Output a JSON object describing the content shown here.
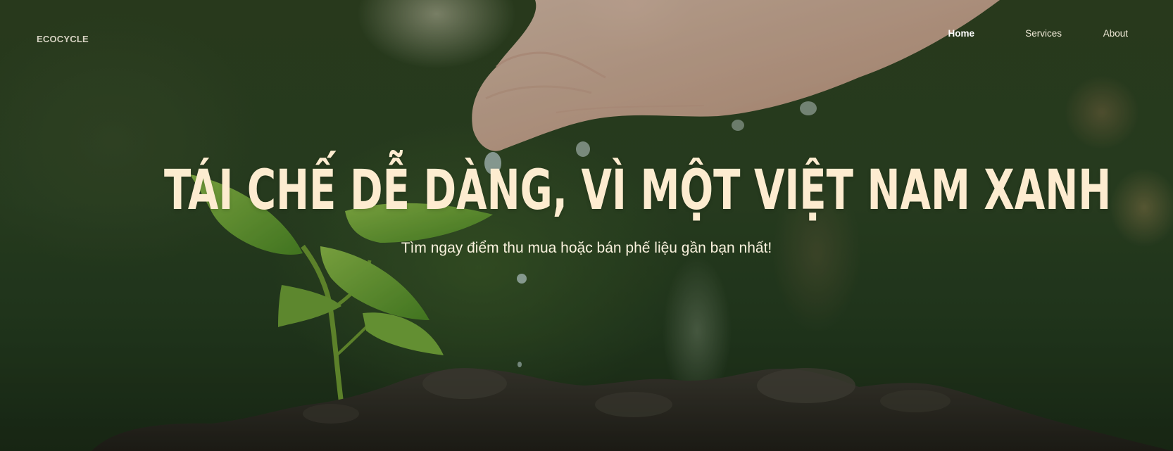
{
  "brand": {
    "logo_text": "ECOCYCLE"
  },
  "nav": {
    "items": [
      {
        "label": "Home",
        "active": true
      },
      {
        "label": "Services",
        "active": false
      },
      {
        "label": "About",
        "active": false
      }
    ]
  },
  "hero": {
    "headline": "TÁI CHẾ DỄ DÀNG, VÌ MỘT VIỆT NAM XANH",
    "subtitle": "Tìm ngay điểm thu mua hoặc bán phế liệu gần bạn nhất!",
    "background_image": "hand watering a young seedling in soil",
    "colors": {
      "headline": "#fdecd0",
      "subtitle": "#fbf3df",
      "nav_text": "#f1ead8",
      "logo_text": "#d6d2c2"
    }
  }
}
